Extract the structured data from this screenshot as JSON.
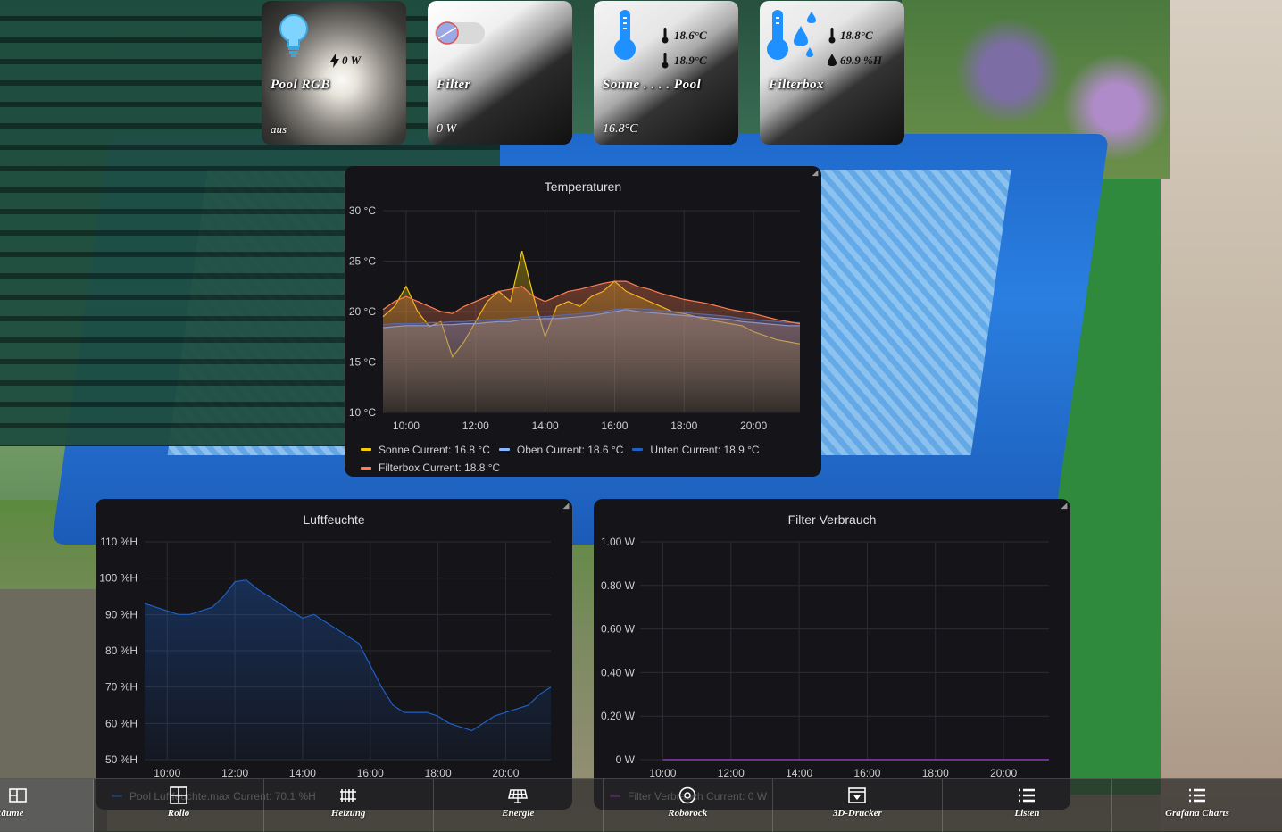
{
  "tiles": {
    "pool_rgb": {
      "title": "Pool RGB",
      "power": "0 W",
      "status": "aus",
      "icon": "bulb-icon"
    },
    "filter": {
      "title": "Filter",
      "status": "0 W",
      "icon": "toggle-icon"
    },
    "sonne_pool": {
      "title": "Sonne . . . . Pool",
      "temp1": "18.6°C",
      "temp2": "18.9°C",
      "status": "16.8°C",
      "icon": "thermometer-icon"
    },
    "filterbox": {
      "title": "Filterbox",
      "temp": "18.8°C",
      "humidity": "69.9 %H",
      "icon": "thermometer-humidity-icon"
    }
  },
  "panels": {
    "temperaturen": {
      "title": "Temperaturen",
      "legend": [
        {
          "name": "Sonne",
          "current": "Current: 16.8 °C",
          "color": "#f2cc0c"
        },
        {
          "name": "Oben",
          "current": "Current: 18.6 °C",
          "color": "#8ab8ff"
        },
        {
          "name": "Unten",
          "current": "Current: 18.9 °C",
          "color": "#1f60c4"
        },
        {
          "name": "Filterbox",
          "current": "Current: 18.8 °C",
          "color": "#ff7f50"
        }
      ]
    },
    "luftfeuchte": {
      "title": "Luftfeuchte",
      "legend": [
        {
          "name": "Pool Luftfeuchte.max",
          "current": "Current: 70.1 %H",
          "color": "#1f60c4"
        }
      ]
    },
    "filter_verbrauch": {
      "title": "Filter Verbrauch",
      "legend": [
        {
          "name": "Filter Verbrauch",
          "current": "Current: 0 W",
          "color": "#8f3bb8"
        }
      ]
    }
  },
  "chart_data": [
    {
      "type": "area",
      "title": "Temperaturen",
      "xlabel": "",
      "ylabel": "",
      "x_ticks": [
        "10:00",
        "12:00",
        "14:00",
        "16:00",
        "18:00",
        "20:00"
      ],
      "y_ticks": [
        "10 °C",
        "15 °C",
        "20 °C",
        "25 °C",
        "30 °C"
      ],
      "ylim": [
        10,
        30
      ],
      "x": [
        "09:20",
        "09:40",
        "10:00",
        "10:20",
        "10:40",
        "11:00",
        "11:20",
        "11:40",
        "12:00",
        "12:20",
        "12:40",
        "13:00",
        "13:20",
        "13:40",
        "14:00",
        "14:20",
        "14:40",
        "15:00",
        "15:20",
        "15:40",
        "16:00",
        "16:20",
        "16:40",
        "17:00",
        "17:20",
        "17:40",
        "18:00",
        "18:20",
        "18:40",
        "19:00",
        "19:20",
        "19:40",
        "20:00",
        "20:20",
        "20:40",
        "21:00",
        "21:20"
      ],
      "series": [
        {
          "name": "Sonne",
          "color": "#f2cc0c",
          "values": [
            19.5,
            20.5,
            22.5,
            20,
            18.5,
            19,
            15.5,
            17,
            19,
            21,
            22,
            21,
            26,
            21.5,
            17.5,
            20.5,
            21,
            20.5,
            21.5,
            22,
            23,
            22,
            21.5,
            21,
            20.5,
            20,
            19.8,
            19.5,
            19.2,
            19,
            18.8,
            18.6,
            18,
            17.6,
            17.2,
            17,
            16.8
          ]
        },
        {
          "name": "Oben",
          "color": "#8ab8ff",
          "values": [
            18.4,
            18.5,
            18.6,
            18.6,
            18.6,
            18.7,
            18.7,
            18.8,
            18.8,
            18.9,
            19,
            19,
            19.2,
            19.2,
            19.3,
            19.3,
            19.4,
            19.5,
            19.6,
            19.8,
            20,
            20.2,
            20,
            19.9,
            19.8,
            19.7,
            19.6,
            19.5,
            19.4,
            19.3,
            19.2,
            19,
            18.9,
            18.8,
            18.7,
            18.6,
            18.6
          ]
        },
        {
          "name": "Unten",
          "color": "#1f60c4",
          "values": [
            18.7,
            18.8,
            18.8,
            18.8,
            18.9,
            18.9,
            19,
            19,
            19.1,
            19.2,
            19.2,
            19.3,
            19.4,
            19.5,
            19.5,
            19.6,
            19.7,
            19.8,
            19.9,
            20,
            20.2,
            20.3,
            20.3,
            20.2,
            20.1,
            20,
            19.9,
            19.8,
            19.7,
            19.6,
            19.5,
            19.3,
            19.2,
            19.1,
            19,
            18.9,
            18.9
          ]
        },
        {
          "name": "Filterbox",
          "color": "#ff7f50",
          "values": [
            20.2,
            21,
            21.5,
            21,
            20.5,
            20,
            19.8,
            20.5,
            21,
            21.5,
            22,
            22.2,
            22.5,
            21.5,
            21,
            21.5,
            22,
            22.2,
            22.5,
            22.8,
            23,
            23,
            22.5,
            22.2,
            21.8,
            21.5,
            21.2,
            21,
            20.8,
            20.5,
            20.2,
            20,
            19.8,
            19.5,
            19.2,
            19,
            18.8
          ]
        }
      ]
    },
    {
      "type": "area",
      "title": "Luftfeuchte",
      "xlabel": "",
      "ylabel": "",
      "x_ticks": [
        "10:00",
        "12:00",
        "14:00",
        "16:00",
        "18:00",
        "20:00"
      ],
      "y_ticks": [
        "50 %H",
        "60 %H",
        "70 %H",
        "80 %H",
        "90 %H",
        "100 %H",
        "110 %H"
      ],
      "ylim": [
        50,
        110
      ],
      "x": [
        "09:20",
        "09:40",
        "10:00",
        "10:20",
        "10:40",
        "11:00",
        "11:20",
        "11:40",
        "12:00",
        "12:20",
        "12:40",
        "13:00",
        "13:20",
        "13:40",
        "14:00",
        "14:20",
        "14:40",
        "15:00",
        "15:20",
        "15:40",
        "16:00",
        "16:20",
        "16:40",
        "17:00",
        "17:20",
        "17:40",
        "18:00",
        "18:20",
        "18:40",
        "19:00",
        "19:20",
        "19:40",
        "20:00",
        "20:20",
        "20:40",
        "21:00",
        "21:20"
      ],
      "series": [
        {
          "name": "Pool Luftfeuchte.max",
          "color": "#1f60c4",
          "values": [
            93,
            92,
            91,
            90,
            90,
            91,
            92,
            95,
            99,
            99.5,
            97,
            95,
            93,
            91,
            89,
            90,
            88,
            86,
            84,
            82,
            76,
            70,
            65,
            63,
            63,
            63,
            62,
            60,
            59,
            58,
            60,
            62,
            63,
            64,
            65,
            68,
            70
          ]
        }
      ]
    },
    {
      "type": "line",
      "title": "Filter Verbrauch",
      "xlabel": "",
      "ylabel": "",
      "x_ticks": [
        "10:00",
        "12:00",
        "14:00",
        "16:00",
        "18:00",
        "20:00"
      ],
      "y_ticks": [
        "0 W",
        "0.20 W",
        "0.40 W",
        "0.60 W",
        "0.80 W",
        "1.00 W"
      ],
      "ylim": [
        0,
        1
      ],
      "x": [
        "10:00",
        "21:20"
      ],
      "series": [
        {
          "name": "Filter Verbrauch",
          "color": "#8f3bb8",
          "values": [
            0,
            0
          ]
        }
      ]
    }
  ],
  "nav": [
    {
      "label": "Räume",
      "icon": "floorplan-icon"
    },
    {
      "label": "Rollo",
      "icon": "window-icon"
    },
    {
      "label": "Heizung",
      "icon": "radiator-icon"
    },
    {
      "label": "Energie",
      "icon": "solar-panel-icon"
    },
    {
      "label": "Roborock",
      "icon": "robot-vacuum-icon"
    },
    {
      "label": "3D-Drucker",
      "icon": "printer-3d-icon"
    },
    {
      "label": "Listen",
      "icon": "list-icon"
    },
    {
      "label": "Grafana Charts",
      "icon": "list-icon"
    }
  ]
}
